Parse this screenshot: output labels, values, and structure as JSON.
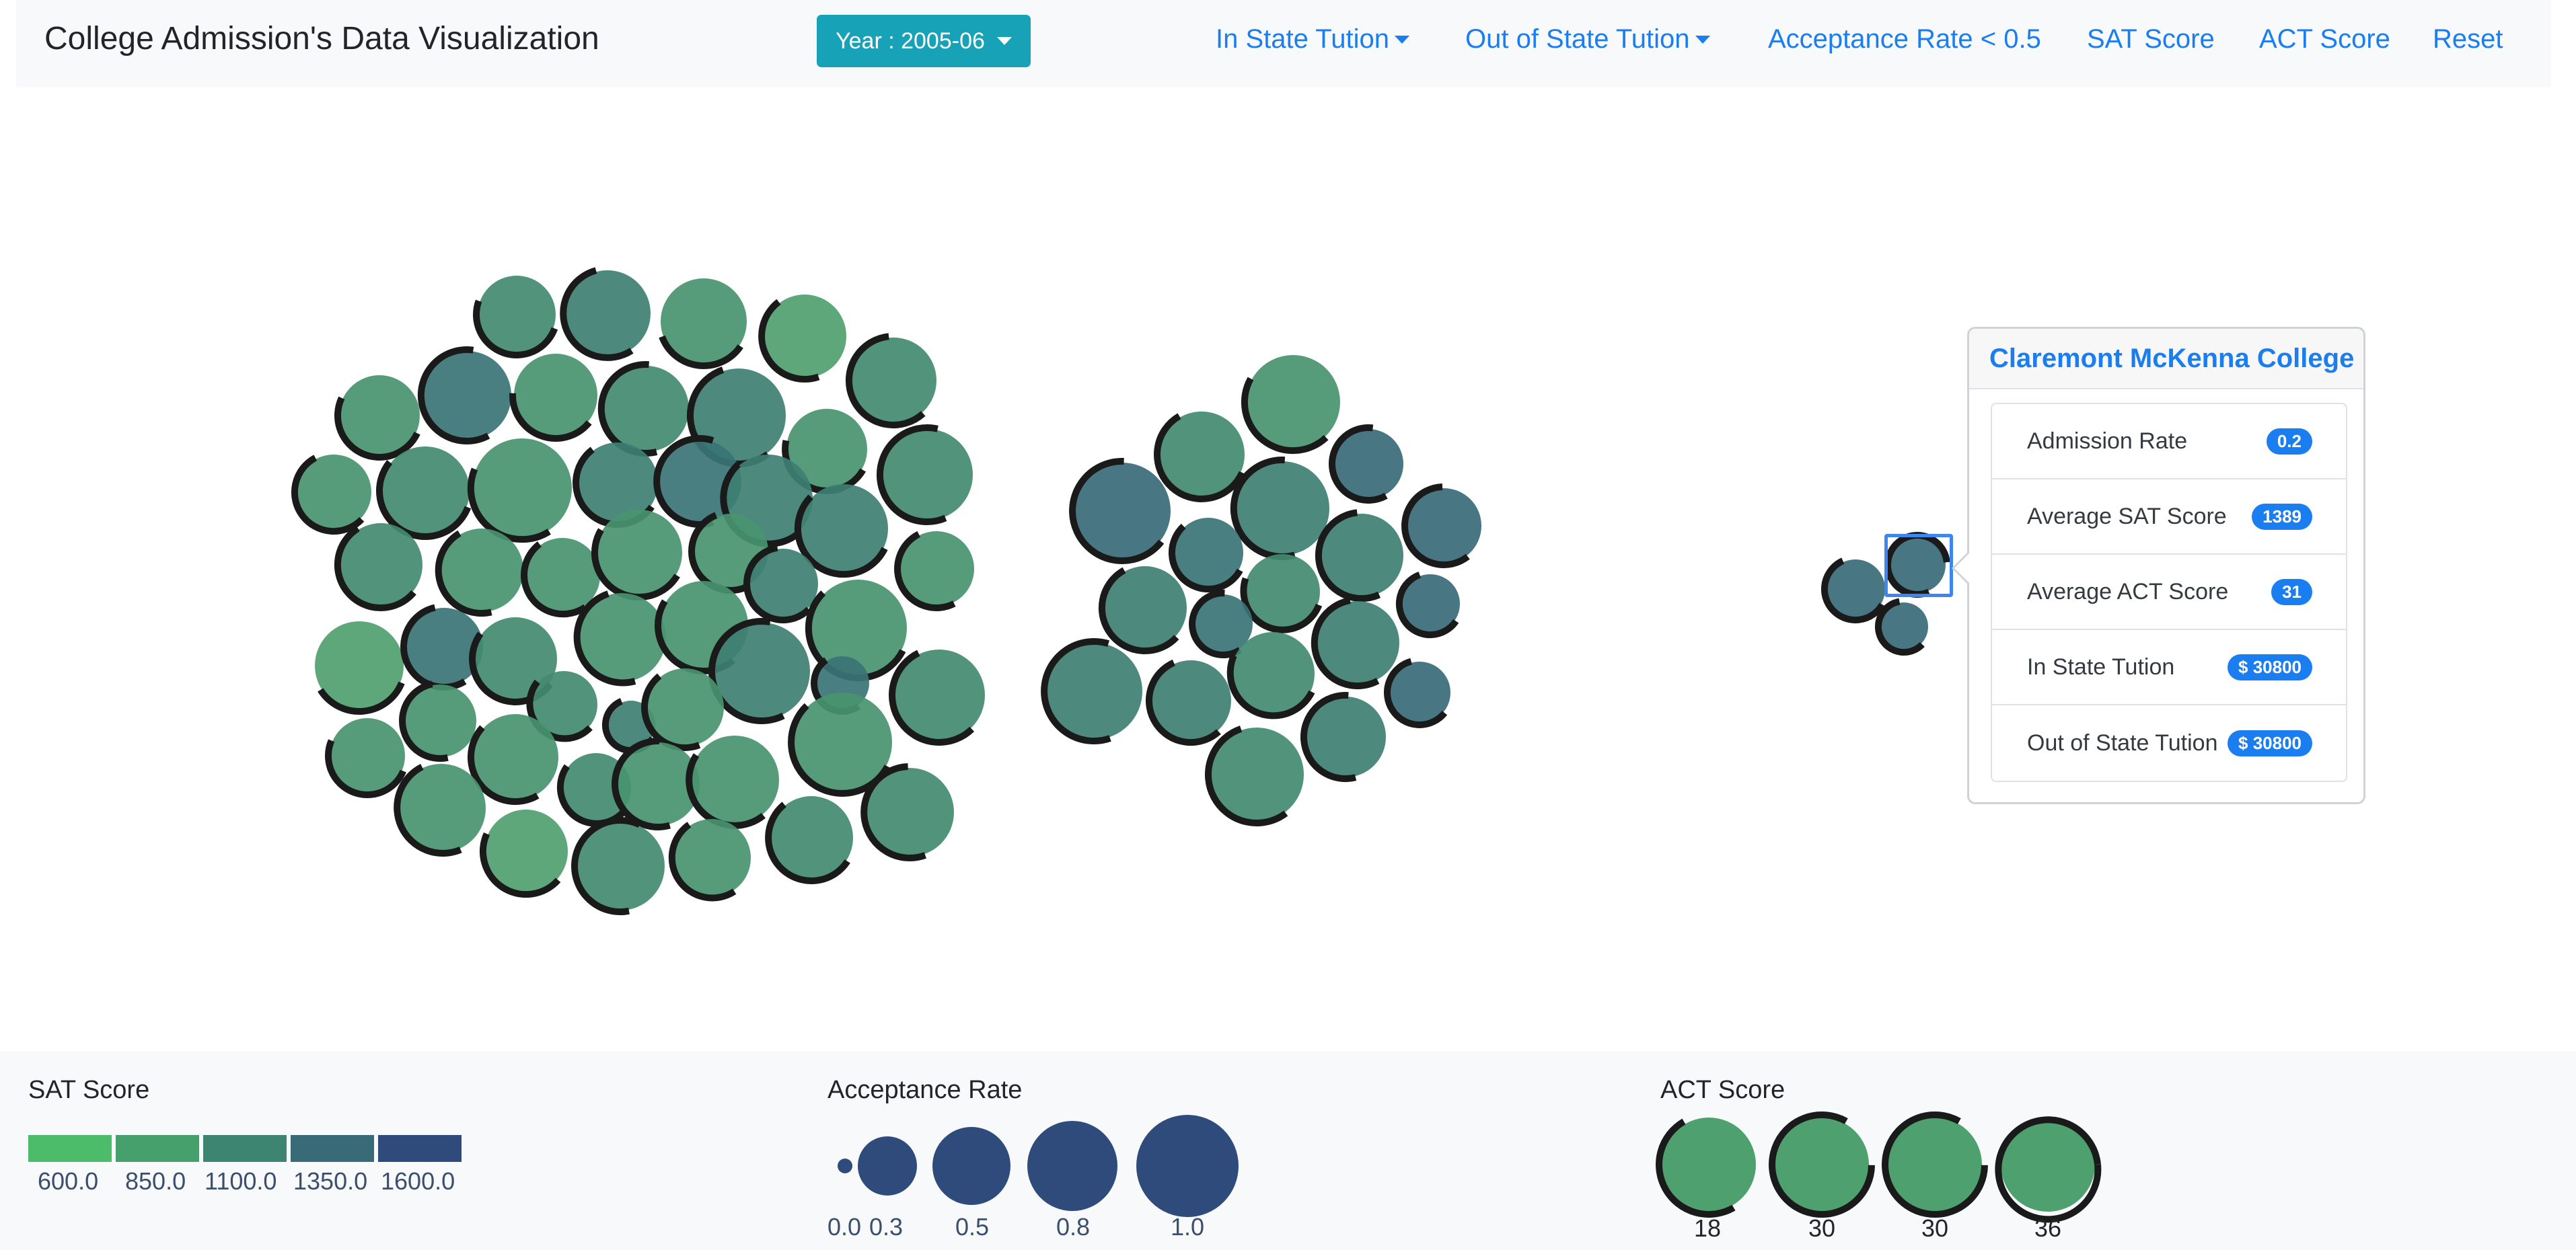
{
  "navbar": {
    "brand": "College Admission's Data Visualization",
    "year_button": "Year : 2005-06",
    "links": [
      {
        "label": "In State Tution",
        "dropdown": true
      },
      {
        "label": "Out of State Tution",
        "dropdown": true
      },
      {
        "label": "Acceptance Rate < 0.5",
        "dropdown": false
      },
      {
        "label": "SAT Score",
        "dropdown": false
      },
      {
        "label": "ACT Score",
        "dropdown": false
      },
      {
        "label": "Reset",
        "dropdown": false
      }
    ]
  },
  "tooltip": {
    "title": "Claremont McKenna College",
    "rows": [
      {
        "label": "Admission Rate",
        "value": "0.2"
      },
      {
        "label": "Average SAT Score",
        "value": "1389"
      },
      {
        "label": "Average ACT Score",
        "value": "31"
      },
      {
        "label": "In State Tution",
        "value": "$ 30800"
      },
      {
        "label": "Out of State Tution",
        "value": "$ 30800"
      }
    ]
  },
  "colors": {
    "accent": "#1a7df0",
    "year_button": "#17a2b8",
    "bubble_ring": "#1a1a1a",
    "size_legend": "#2f4b7c",
    "sat_scale": [
      "#4cbb6a",
      "#45a06b",
      "#3d8570",
      "#386a78",
      "#2f4b7c"
    ]
  },
  "legend": {
    "sat": {
      "title": "SAT Score",
      "ticks": [
        "600.0",
        "850.0",
        "1100.0",
        "1350.0",
        "1600.0"
      ]
    },
    "acceptance": {
      "title": "Acceptance Rate",
      "ticks": [
        "0.0",
        "0.3",
        "0.5",
        "0.8",
        "1.0"
      ]
    },
    "act": {
      "title": "ACT Score",
      "ticks": [
        "18",
        "30",
        "30",
        "36"
      ]
    }
  }
}
